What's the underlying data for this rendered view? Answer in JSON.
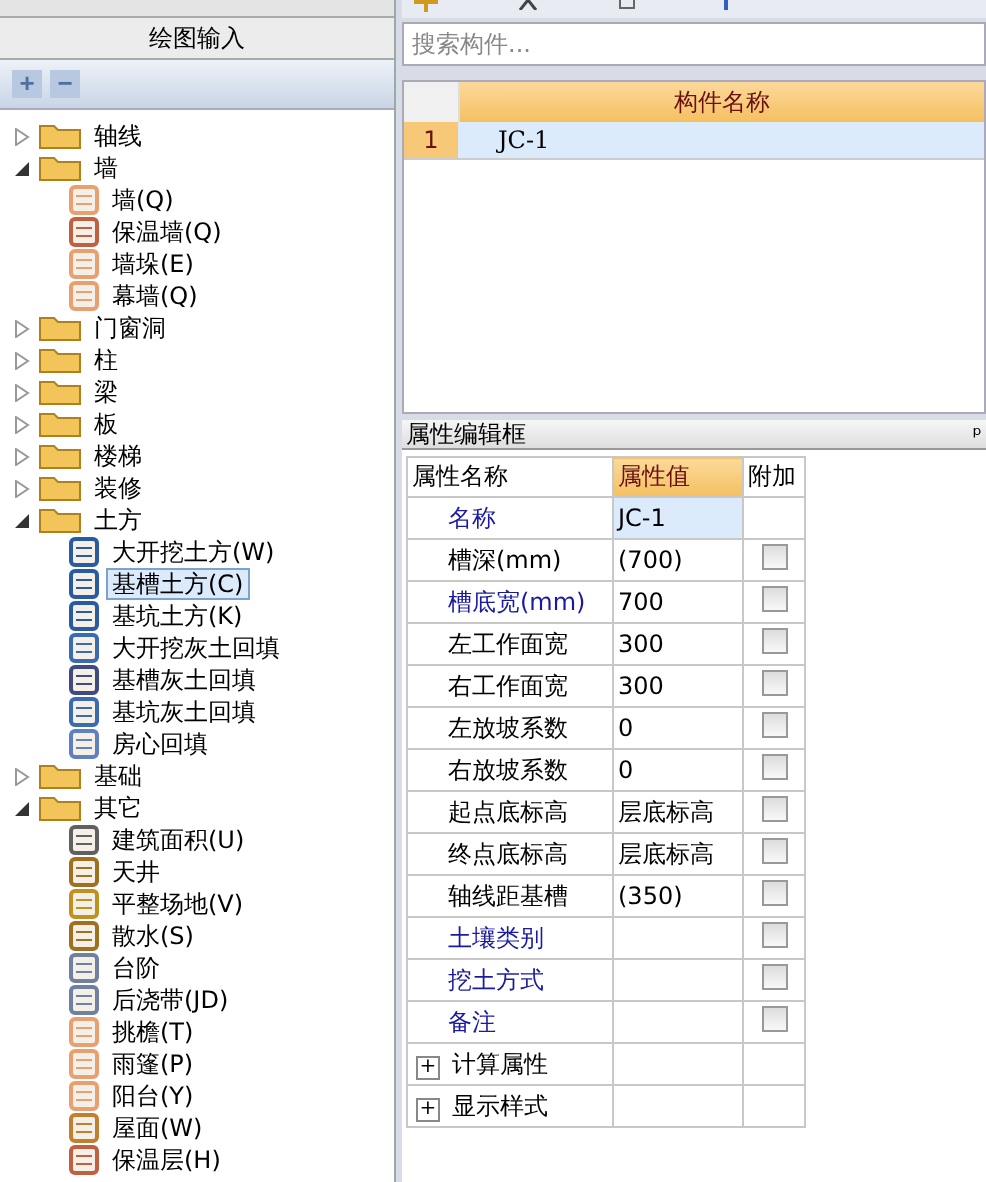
{
  "panel_heading": "绘图输入",
  "tree_toolbar": {
    "expand": "+",
    "collapse": "−"
  },
  "tree": [
    {
      "label": "轴线",
      "kind": "folder",
      "expanded": false,
      "selected": false
    },
    {
      "label": "墙",
      "kind": "folder",
      "expanded": true,
      "selected": false,
      "children": [
        {
          "label": "墙(Q)",
          "kind": "brick",
          "selected": false
        },
        {
          "label": "保温墙(Q)",
          "kind": "insulation",
          "selected": false
        },
        {
          "label": "墙垛(E)",
          "kind": "brick",
          "selected": false
        },
        {
          "label": "幕墙(Q)",
          "kind": "brick",
          "selected": false
        }
      ]
    },
    {
      "label": "门窗洞",
      "kind": "folder",
      "expanded": false,
      "selected": false
    },
    {
      "label": "柱",
      "kind": "folder",
      "expanded": false,
      "selected": false
    },
    {
      "label": "梁",
      "kind": "folder",
      "expanded": false,
      "selected": false
    },
    {
      "label": "板",
      "kind": "folder",
      "expanded": false,
      "selected": false
    },
    {
      "label": "楼梯",
      "kind": "folder",
      "expanded": false,
      "selected": false
    },
    {
      "label": "装修",
      "kind": "folder",
      "expanded": false,
      "selected": false
    },
    {
      "label": "土方",
      "kind": "folder",
      "expanded": true,
      "selected": false,
      "children": [
        {
          "label": "大开挖土方(W)",
          "kind": "pit",
          "selected": false
        },
        {
          "label": "基槽土方(C)",
          "kind": "pit",
          "selected": true
        },
        {
          "label": "基坑土方(K)",
          "kind": "pit",
          "selected": false
        },
        {
          "label": "大开挖灰土回填",
          "kind": "fill",
          "selected": false
        },
        {
          "label": "基槽灰土回填",
          "kind": "hatch",
          "selected": false
        },
        {
          "label": "基坑灰土回填",
          "kind": "fill",
          "selected": false
        },
        {
          "label": "房心回填",
          "kind": "tray",
          "selected": false
        }
      ]
    },
    {
      "label": "基础",
      "kind": "folder",
      "expanded": false,
      "selected": false
    },
    {
      "label": "其它",
      "kind": "folder",
      "expanded": true,
      "selected": false,
      "children": [
        {
          "label": "建筑面积(U)",
          "kind": "area",
          "selected": false
        },
        {
          "label": "天井",
          "kind": "square",
          "selected": false
        },
        {
          "label": "平整场地(V)",
          "kind": "shovel",
          "selected": false
        },
        {
          "label": "散水(S)",
          "kind": "square",
          "selected": false
        },
        {
          "label": "台阶",
          "kind": "steps",
          "selected": false
        },
        {
          "label": "后浇带(JD)",
          "kind": "steps",
          "selected": false
        },
        {
          "label": "挑檐(T)",
          "kind": "brick",
          "selected": false
        },
        {
          "label": "雨篷(P)",
          "kind": "brick",
          "selected": false
        },
        {
          "label": "阳台(Y)",
          "kind": "brick",
          "selected": false
        },
        {
          "label": "屋面(W)",
          "kind": "house",
          "selected": false
        },
        {
          "label": "保温层(H)",
          "kind": "insulation",
          "selected": false
        }
      ]
    }
  ],
  "search": {
    "placeholder": "搜索构件..."
  },
  "component_table": {
    "columns": [
      "构件名称"
    ],
    "rows": [
      {
        "index": "1",
        "name": "JC-1",
        "selected": true
      }
    ]
  },
  "properties": {
    "title": "属性编辑框",
    "pin": "ᵖ",
    "columns": [
      "属性名称",
      "属性值",
      "附加"
    ],
    "rows": [
      {
        "name": "名称",
        "value": "JC-1",
        "kind": "field",
        "public": true,
        "selected": true
      },
      {
        "name": "槽深(mm)",
        "value": "(700)",
        "kind": "check",
        "public": false,
        "checked": false,
        "selected": false
      },
      {
        "name": "槽底宽(mm)",
        "value": "700",
        "kind": "check",
        "public": true,
        "checked": false,
        "selected": false
      },
      {
        "name": "左工作面宽",
        "value": "300",
        "kind": "check",
        "public": false,
        "checked": false,
        "selected": false
      },
      {
        "name": "右工作面宽",
        "value": "300",
        "kind": "check",
        "public": false,
        "checked": false,
        "selected": false
      },
      {
        "name": "左放坡系数",
        "value": "0",
        "kind": "check",
        "public": false,
        "checked": false,
        "selected": false
      },
      {
        "name": "右放坡系数",
        "value": "0",
        "kind": "check",
        "public": false,
        "checked": false,
        "selected": false
      },
      {
        "name": "起点底标高",
        "value": "层底标高",
        "kind": "check",
        "public": false,
        "checked": false,
        "selected": false
      },
      {
        "name": "终点底标高",
        "value": "层底标高",
        "kind": "check",
        "public": false,
        "checked": false,
        "selected": false
      },
      {
        "name": "轴线距基槽",
        "value": "(350)",
        "kind": "check",
        "public": false,
        "checked": false,
        "selected": false
      },
      {
        "name": "土壤类别",
        "value": "",
        "kind": "check",
        "public": true,
        "checked": false,
        "selected": false
      },
      {
        "name": "挖土方式",
        "value": "",
        "kind": "check",
        "public": true,
        "checked": false,
        "selected": false
      },
      {
        "name": "备注",
        "value": "",
        "kind": "check",
        "public": true,
        "checked": false,
        "selected": false
      },
      {
        "name": "计算属性",
        "value": "",
        "kind": "group",
        "expand_mark": "+",
        "selected": false
      },
      {
        "name": "显示样式",
        "value": "",
        "kind": "group",
        "expand_mark": "+",
        "selected": false
      }
    ]
  }
}
